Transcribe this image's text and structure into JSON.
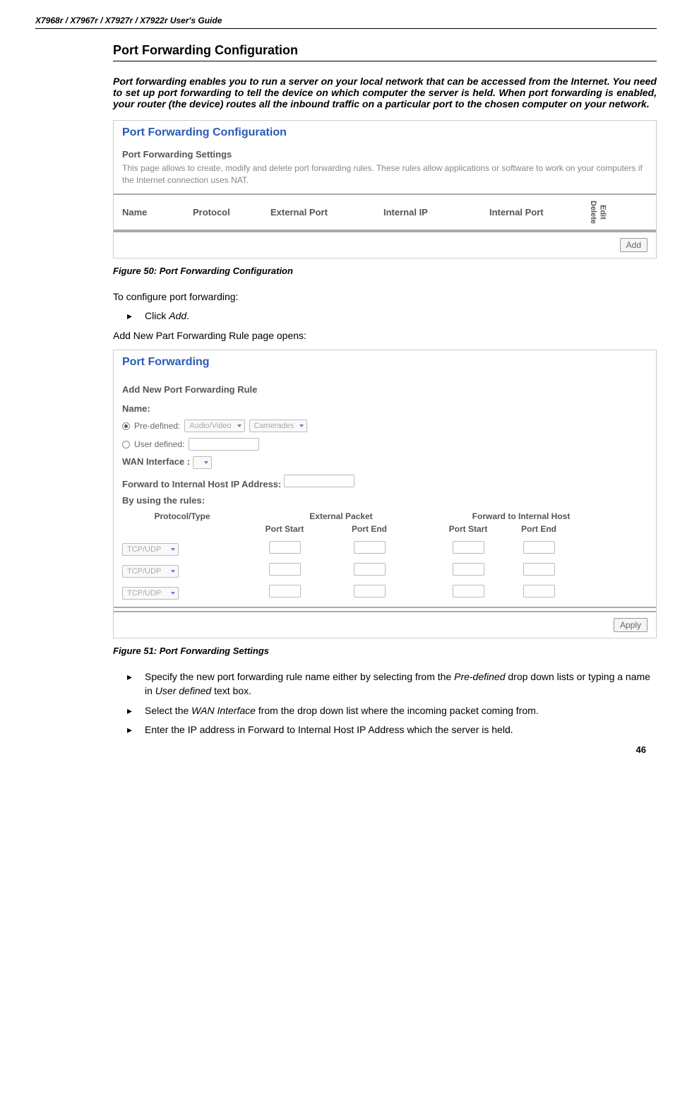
{
  "header": {
    "models": "X7968r / X7967r / X7927r / X7922r",
    "suffix": " User's Guide"
  },
  "title": "Port Forwarding Configuration",
  "intro": "Port forwarding enables you to run a server on your local network that can be accessed from the Internet. You need to set up port forwarding to tell the device on which computer the server is held. When port forwarding is enabled, your router (the device) routes all the inbound traffic on a particular port to the chosen computer on your network.",
  "fig1": {
    "title": "Port Forwarding Configuration",
    "subtitle": "Port Forwarding Settings",
    "desc": "This page allows to create, modify and delete port forwarding rules. These rules allow applications or software to work on your computers if the Internet connection uses NAT.",
    "cols": {
      "name": "Name",
      "protocol": "Protocol",
      "extport": "External Port",
      "intip": "Internal IP",
      "intport": "Internal Port",
      "delete": "Delete",
      "edit": "Edit"
    },
    "addBtn": "Add"
  },
  "caption1": "Figure 50: Port Forwarding Configuration",
  "body1": "To configure port forwarding:",
  "bullet1": {
    "prefix": "Click ",
    "em": "Add",
    "suffix": "."
  },
  "body2": "Add New Part Forwarding Rule page opens:",
  "fig2": {
    "title": "Port Forwarding",
    "subtitle": "Add New Port Forwarding Rule",
    "labels": {
      "name": "Name:",
      "predefined": "Pre-defined:",
      "predef_opt": "Audio/Video",
      "predef_sub": "Camerades",
      "userdefined": "User defined:",
      "waninterface": "WAN Interface :",
      "forwardto": "Forward to Internal Host IP Address:",
      "byrules": "By using the rules:",
      "prototype": "Protocol/Type",
      "extpacket": "External Packet",
      "fwdhost": "Forward to Internal Host",
      "portstart": "Port Start",
      "portend": "Port End",
      "tcpudp": "TCP/UDP"
    },
    "applyBtn": "Apply"
  },
  "caption2": "Figure 51: Port Forwarding Settings",
  "bullets2": [
    {
      "parts": [
        {
          "t": "Specify the new port forwarding rule name either by selecting from the "
        },
        {
          "t": "Pre-defined",
          "em": true
        },
        {
          "t": " drop down lists or typing a name in "
        },
        {
          "t": "User defined",
          "em": true
        },
        {
          "t": " text box."
        }
      ]
    },
    {
      "parts": [
        {
          "t": "Select the "
        },
        {
          "t": "WAN Interface",
          "em": true
        },
        {
          "t": " from the drop down list where the incoming packet coming from."
        }
      ]
    },
    {
      "parts": [
        {
          "t": "Enter the IP address in Forward to Internal Host IP Address which the server is held."
        }
      ]
    }
  ],
  "pageNum": "46"
}
